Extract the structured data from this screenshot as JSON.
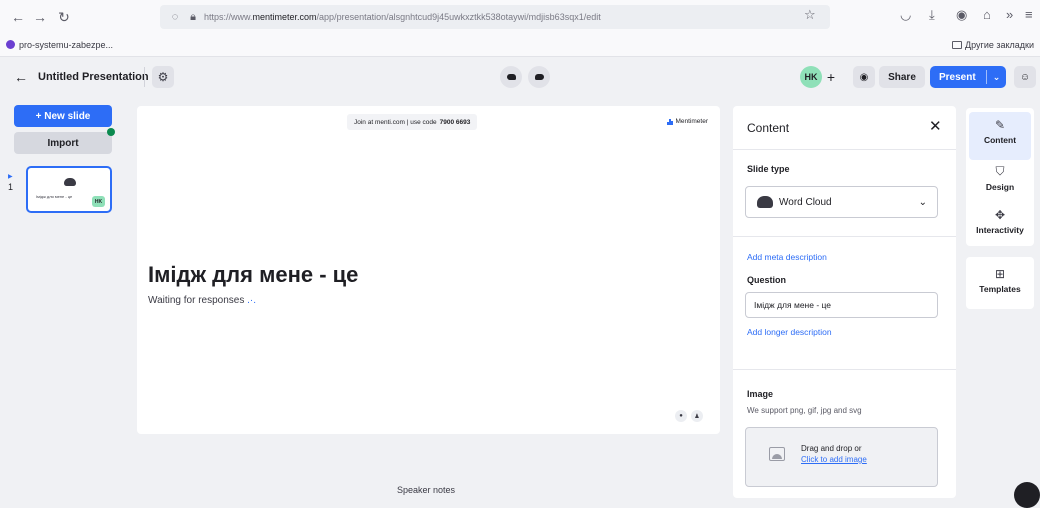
{
  "browser": {
    "url_prefix": "https://www.",
    "url_domain": "mentimeter.com",
    "url_path": "/app/presentation/alsgnhtcud9j45uwkxztkk538otaywi/mdjisb63sqx1/edit",
    "bookmark": "pro-systemu-zabezpe...",
    "bookmarks_other": "Другие закладки"
  },
  "header": {
    "title": "Untitled Presentation",
    "avatar_initials": "HK",
    "share_label": "Share",
    "present_label": "Present"
  },
  "left_panel": {
    "new_slide_label": "+ New slide",
    "import_label": "Import",
    "slides": [
      {
        "number": "1",
        "thumb_text": "Імідж для мене - це",
        "avatar_initials": "HK"
      }
    ]
  },
  "canvas": {
    "join_text": "Join at menti.com | use code",
    "join_code": "7900 6693",
    "brand": "Mentimeter",
    "question": "Імідж для мене - це",
    "waiting_text": "Waiting for responses",
    "waiting_dots": " .·."
  },
  "speaker_notes_label": "Speaker notes",
  "content_panel": {
    "title": "Content",
    "slide_type_label": "Slide type",
    "slide_type_value": "Word Cloud",
    "add_meta_link": "Add meta description",
    "question_label": "Question",
    "question_value": "Імідж для мене - це",
    "add_longer_link": "Add longer description",
    "image_label": "Image",
    "image_hint": "We support png, gif, jpg and svg",
    "drop_text": "Drag and drop or",
    "drop_link": "Click to add image"
  },
  "right_rail": {
    "items": [
      {
        "label": "Content",
        "icon": "pencil-icon"
      },
      {
        "label": "Design",
        "icon": "paint-bucket-icon"
      },
      {
        "label": "Interactivity",
        "icon": "interactivity-icon"
      },
      {
        "label": "Templates",
        "icon": "templates-icon"
      }
    ]
  },
  "colors": {
    "accent": "#2d6df6",
    "avatar": "#8fe0b8",
    "background": "#f0f1f4"
  }
}
